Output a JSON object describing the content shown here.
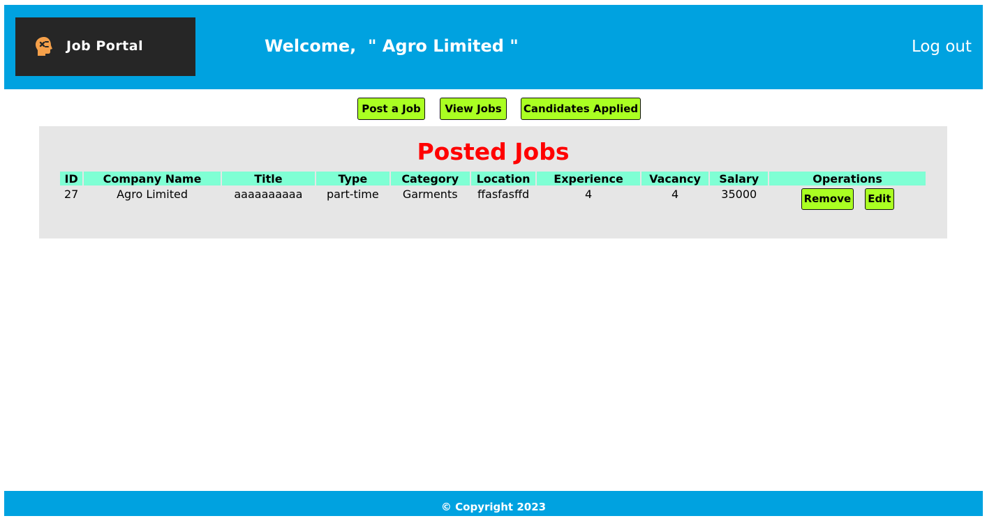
{
  "header": {
    "logo_text": "Job Portal",
    "logo_icon": "head-icon",
    "welcome_text": "Welcome,  \" Agro Limited \"",
    "logout_label": "Log out"
  },
  "nav": {
    "post_job_label": "Post a Job",
    "view_jobs_label": "View Jobs",
    "candidates_label": "Candidates Applied"
  },
  "main": {
    "title": "Posted Jobs",
    "columns": [
      "ID",
      "Company Name",
      "Title",
      "Type",
      "Category",
      "Location",
      "Experience",
      "Vacancy",
      "Salary",
      "Operations"
    ],
    "rows": [
      {
        "id": "27",
        "company": "Agro Limited",
        "title": "aaaaaaaaaa",
        "type": "part-time",
        "category": "Garments",
        "location": "ffasfasffd",
        "experience": "4",
        "vacancy": "4",
        "salary": "35000",
        "remove_label": "Remove",
        "edit_label": "Edit"
      }
    ]
  },
  "footer": {
    "copyright": "© Copyright 2023"
  },
  "colors": {
    "header_bg": "#00a2e0",
    "logo_bg": "#262626",
    "button_bg": "#aaff22",
    "table_header_bg": "#7fffd4",
    "panel_bg": "#e6e6e6",
    "title_color": "#ff0000"
  }
}
